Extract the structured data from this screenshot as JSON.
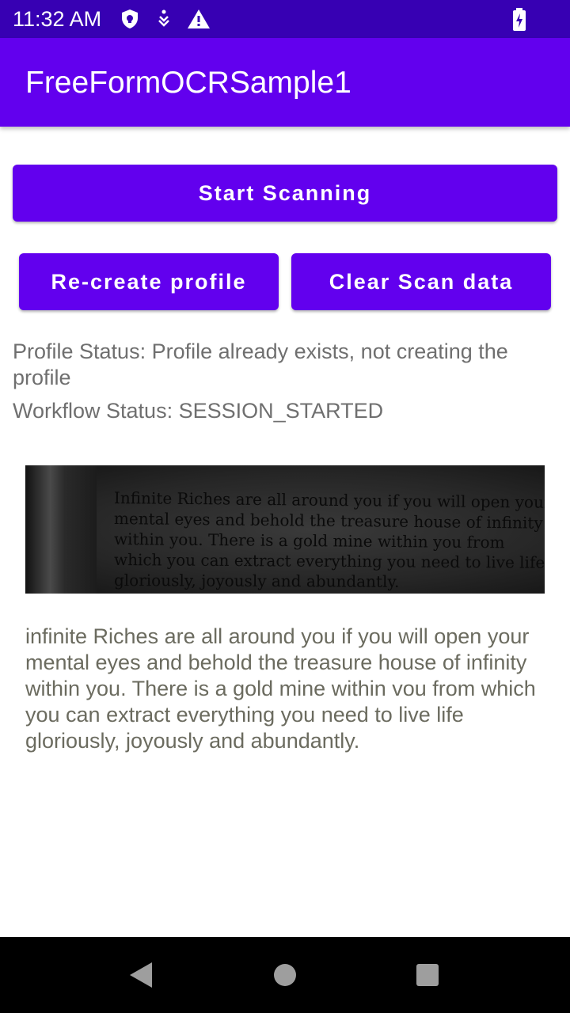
{
  "status_bar": {
    "time": "11:32 AM",
    "icons": [
      "shield-icon",
      "download-icon",
      "warning-icon",
      "battery-charging-icon"
    ]
  },
  "app_bar": {
    "title": "FreeFormOCRSample1"
  },
  "buttons": {
    "start_scanning": "Start Scanning",
    "recreate_profile": "Re-create profile",
    "clear_scan_data": "Clear Scan data"
  },
  "status": {
    "profile": "Profile Status: Profile already exists, not creating the profile",
    "workflow": "Workflow Status: SESSION_STARTED"
  },
  "scan_image": {
    "lines": [
      "Infinite Riches are all around you if you will open your",
      "mental eyes and behold the treasure house of infinity",
      "within you. There is a gold mine within you from",
      "which you can extract everything you need to live life",
      "gloriously, joyously and abundantly."
    ]
  },
  "ocr_result": "infinite Riches are all around you if you will open your mental eyes and behold the treasure house of infinity within you. There is a gold mine within vou from which you can extract everything you need to live life gloriously, joyously and abundantly.",
  "nav_bar": {
    "icons": [
      "back-icon",
      "home-icon",
      "recents-icon"
    ]
  },
  "colors": {
    "status_bar": "#3700b3",
    "primary": "#6200ee",
    "status_text": "#6f6f6f",
    "ocr_text": "#6b6b5f"
  }
}
